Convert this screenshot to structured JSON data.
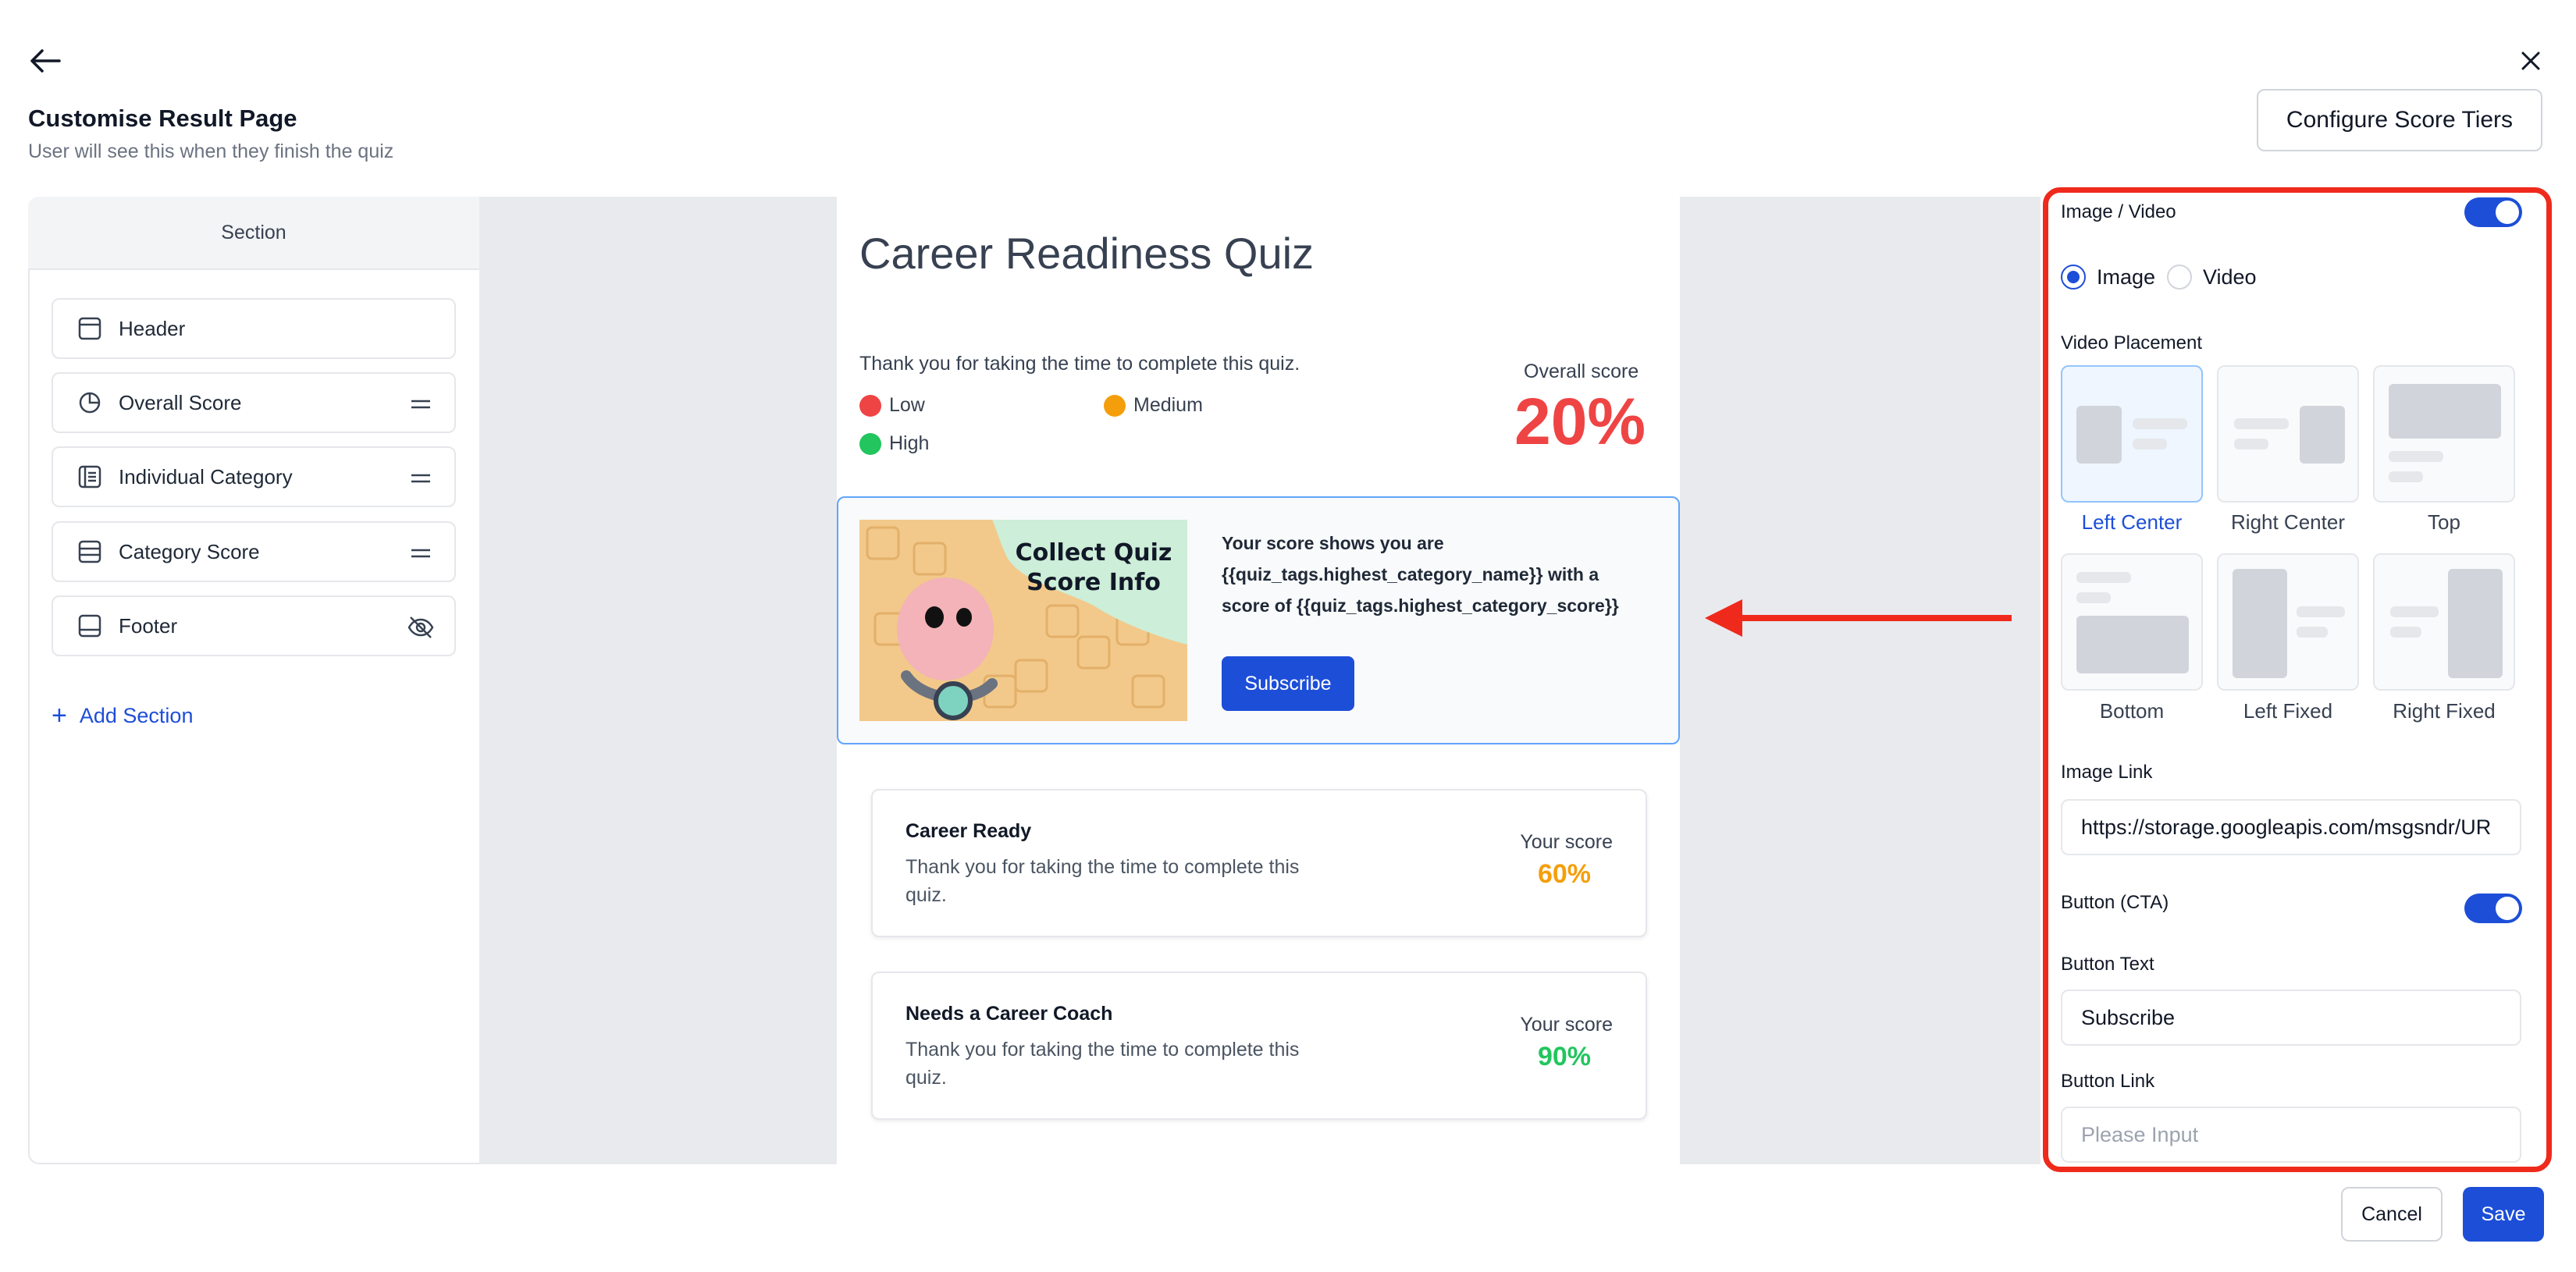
{
  "header": {
    "title": "Customise Result Page",
    "subtitle": "User will see this when they finish the quiz",
    "configure_button": "Configure Score Tiers"
  },
  "sidebar": {
    "heading": "Section",
    "items": [
      {
        "label": "Header",
        "icon": "layout-header-icon"
      },
      {
        "label": "Overall Score",
        "icon": "pie-chart-icon",
        "action_icon": "drag-handle-icon"
      },
      {
        "label": "Individual Category",
        "icon": "list-icon",
        "action_icon": "drag-handle-icon"
      },
      {
        "label": "Category Score",
        "icon": "rows-icon",
        "action_icon": "drag-handle-icon"
      },
      {
        "label": "Footer",
        "icon": "layout-footer-icon",
        "action_icon": "eye-off-icon"
      }
    ],
    "add_section": "Add Section"
  },
  "preview": {
    "quiz_title": "Career Readiness Quiz",
    "thanks_text": "Thank you for taking the time to complete this quiz.",
    "legend": [
      {
        "label": "Low",
        "color": "#ef4444"
      },
      {
        "label": "Medium",
        "color": "#f59e0b"
      },
      {
        "label": "High",
        "color": "#22c55e"
      }
    ],
    "overall_label": "Overall score",
    "overall_value": "20%",
    "promo": {
      "image_title_line1": "Collect Quiz",
      "image_title_line2": "Score Info",
      "text": "Your score shows you are {{quiz_tags.highest_category_name}} with a score of {{quiz_tags.highest_category_score}}",
      "button": "Subscribe"
    },
    "categories": [
      {
        "name": "Career Ready",
        "desc": "Thank you for taking the time to complete this quiz.",
        "score_label": "Your score",
        "score": "60%",
        "color": "#f59e0b"
      },
      {
        "name": "Needs a Career Coach",
        "desc": "Thank you for taking the time to complete this quiz.",
        "score_label": "Your score",
        "score": "90%",
        "color": "#22c55e"
      }
    ]
  },
  "panel": {
    "media_label": "Image / Video",
    "media_enabled": true,
    "radio_image": "Image",
    "radio_video": "Video",
    "selected_media": "Image",
    "placement_label": "Video Placement",
    "placements": [
      "Left Center",
      "Right Center",
      "Top",
      "Bottom",
      "Left Fixed",
      "Right Fixed"
    ],
    "selected_placement": "Left Center",
    "image_link_label": "Image Link",
    "image_link_value": "https://storage.googleapis.com/msgsndr/UR",
    "cta_label": "Button (CTA)",
    "cta_enabled": true,
    "button_text_label": "Button Text",
    "button_text_value": "Subscribe",
    "button_link_label": "Button Link",
    "button_link_placeholder": "Please Input"
  },
  "footer": {
    "cancel": "Cancel",
    "save": "Save"
  },
  "colors": {
    "accent": "#1d4ed8",
    "highlight_border": "#ef2a1c",
    "overall_score": "#ef4444"
  }
}
